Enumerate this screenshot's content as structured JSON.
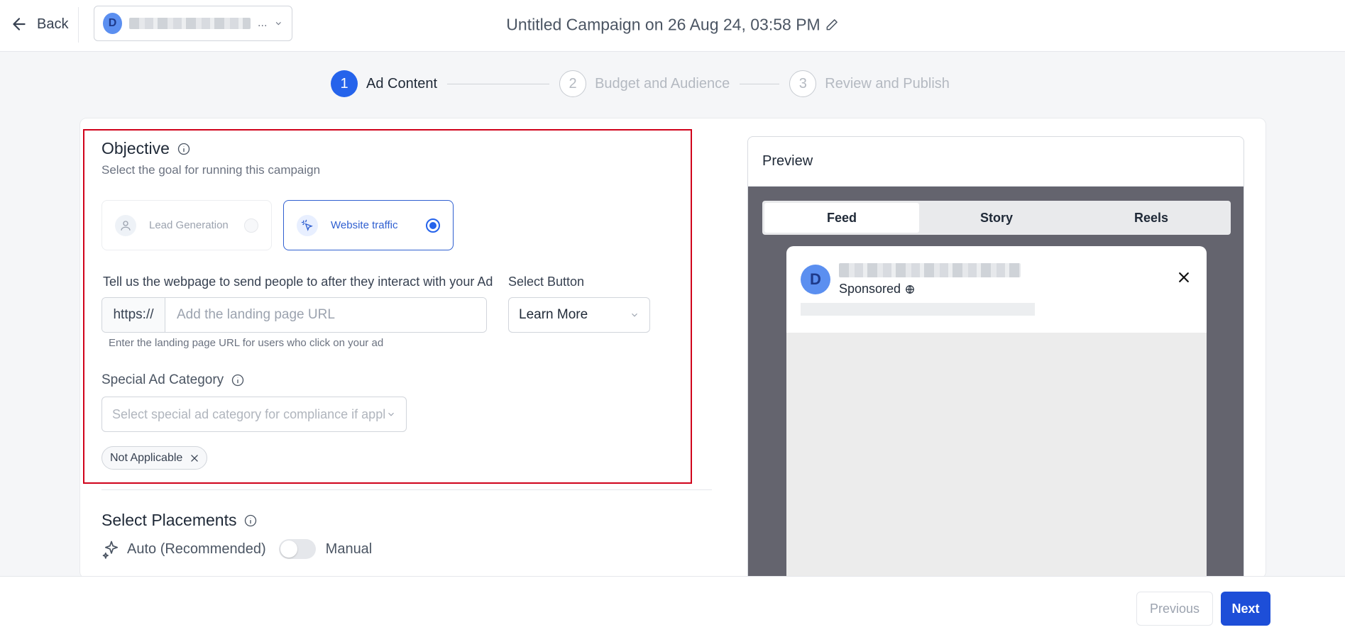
{
  "header": {
    "back_label": "Back",
    "account_initial": "D",
    "account_ellipsis": "...",
    "campaign_title": "Untitled Campaign on 26 Aug 24, 03:58 PM"
  },
  "stepper": {
    "steps": [
      {
        "number": "1",
        "label": "Ad Content"
      },
      {
        "number": "2",
        "label": "Budget and Audience"
      },
      {
        "number": "3",
        "label": "Review and Publish"
      }
    ]
  },
  "objective": {
    "title": "Objective",
    "subtitle": "Select the goal for running this campaign",
    "options": [
      {
        "label": "Lead Generation"
      },
      {
        "label": "Website traffic"
      }
    ]
  },
  "webpage": {
    "label": "Tell us the webpage to send people to after they interact with your Ad",
    "prefix": "https://",
    "placeholder": "Add the landing page URL",
    "help": "Enter the landing page URL for users who click on your ad"
  },
  "select_button": {
    "label": "Select Button",
    "value": "Learn More"
  },
  "special_category": {
    "title": "Special Ad Category",
    "placeholder": "Select special ad category for compliance if applicable",
    "tag": "Not Applicable"
  },
  "placements": {
    "title": "Select Placements",
    "auto_label": "Auto (Recommended)",
    "manual_label": "Manual"
  },
  "preview": {
    "title": "Preview",
    "tabs": [
      "Feed",
      "Story",
      "Reels"
    ],
    "avatar_initial": "D",
    "sponsored": "Sponsored"
  },
  "footer": {
    "previous": "Previous",
    "next": "Next"
  },
  "colors": {
    "accent": "#2563eb",
    "highlight_border": "#d0021b",
    "preview_backdrop": "#64646e"
  }
}
